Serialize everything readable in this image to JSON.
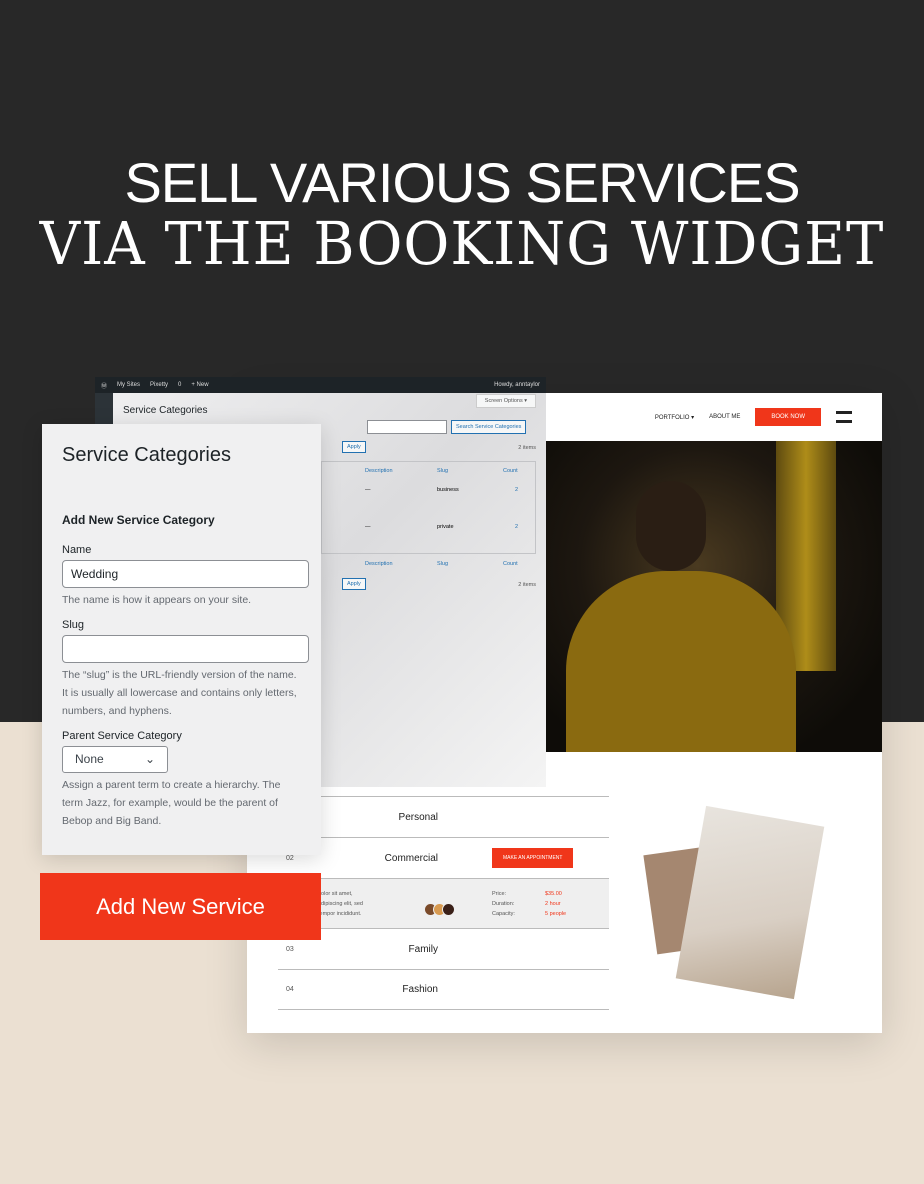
{
  "headline": {
    "line1": "SELL VARIOUS SERVICES",
    "line2": "VIA THE BOOKING WIDGET"
  },
  "site": {
    "nav": {
      "portfolio": "PORTFOLIO ▾",
      "about": "ABOUT ME",
      "book": "BOOK NOW"
    },
    "services": [
      {
        "num": "",
        "name": "Personal"
      },
      {
        "num": "02",
        "name": "Commercial",
        "button": "MAKE AN APPOINTMENT"
      },
      {
        "num": "03",
        "name": "Family"
      },
      {
        "num": "04",
        "name": "Fashion"
      }
    ],
    "details": {
      "text": [
        "dolor sit amet,",
        "adipiscing elit, sed",
        "tempor incididunt."
      ],
      "labels": [
        "Price:",
        "Duration:",
        "Capacity:"
      ],
      "values": [
        "$35.00",
        "2 hour",
        "5 people"
      ]
    }
  },
  "wp": {
    "bar": {
      "my_sites": "My Sites",
      "site": "Pixetty",
      "comments": "0",
      "new": "+ New",
      "howdy": "Howdy, anntaylor"
    },
    "title": "Service Categories",
    "screen_options": "Screen Options ▾",
    "search_button": "Search Service Categories",
    "apply": "Apply",
    "items": "2 items",
    "columns": [
      "Description",
      "Slug",
      "Count"
    ],
    "rows": [
      {
        "description": "—",
        "slug": "business",
        "count": "2"
      },
      {
        "description": "—",
        "slug": "private",
        "count": "2"
      }
    ]
  },
  "form": {
    "title": "Service Categories",
    "subtitle": "Add New Service Category",
    "name_label": "Name",
    "name_value": "Wedding",
    "name_help": "The name is how it appears on your site.",
    "slug_label": "Slug",
    "slug_value": "",
    "slug_help": "The “slug” is the URL-friendly version of the name. It is usually all lowercase and contains only letters, numbers, and hyphens.",
    "parent_label": "Parent Service Category",
    "parent_value": "None",
    "parent_help": "Assign a parent term to create a hierarchy. The term Jazz, for example, would be the parent of Bebop and Big Band."
  },
  "cta": "Add New Service",
  "colors": {
    "accent": "#f0361a",
    "dark": "#282828",
    "beige": "#ebe0d2"
  }
}
